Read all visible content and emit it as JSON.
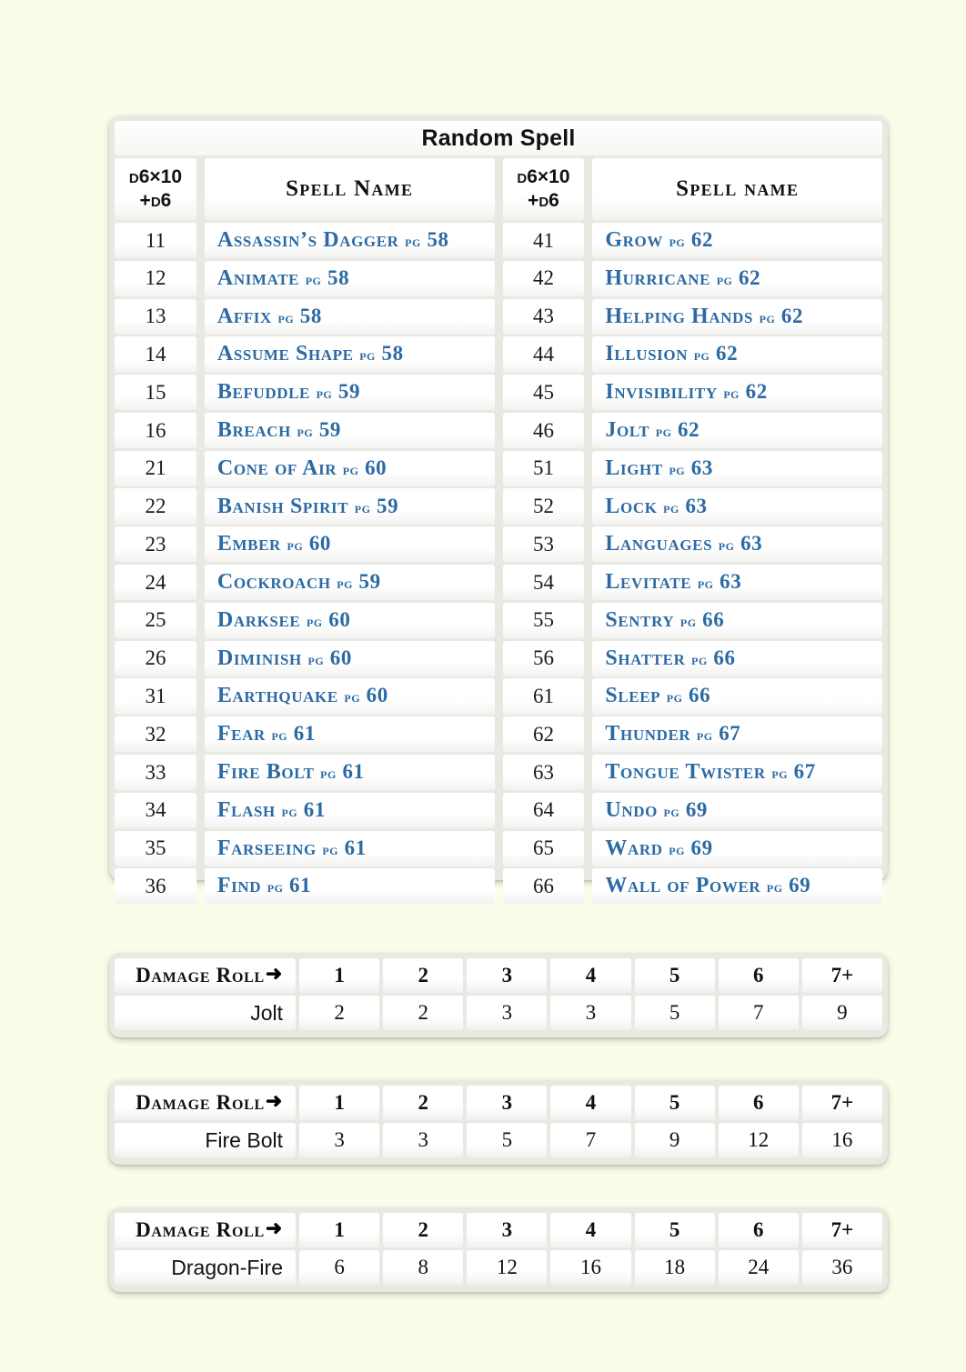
{
  "background_color": "#fbfce9",
  "accent_color": "#2b6aa4",
  "spell_table": {
    "title": "Random Spell",
    "headers": {
      "roll_line1": "D6×10",
      "roll_line2": "+D6",
      "name_left": "Spell Name",
      "name_right": "Spell name"
    },
    "left_column": [
      {
        "roll": "11",
        "name": "Assassin’s Dagger",
        "pg": "pg",
        "page": "58"
      },
      {
        "roll": "12",
        "name": "Animate",
        "pg": "pg",
        "page": "58"
      },
      {
        "roll": "13",
        "name": "Affix",
        "pg": "pg",
        "page": "58"
      },
      {
        "roll": "14",
        "name": "Assume Shape",
        "pg": "pg",
        "page": "58"
      },
      {
        "roll": "15",
        "name": "Befuddle",
        "pg": "pg",
        "page": "59"
      },
      {
        "roll": "16",
        "name": "Breach",
        "pg": "pg",
        "page": "59"
      },
      {
        "roll": "21",
        "name": "Cone of Air",
        "pg": "pg",
        "page": "60"
      },
      {
        "roll": "22",
        "name": "Banish Spirit",
        "pg": "pg",
        "page": "59"
      },
      {
        "roll": "23",
        "name": "Ember",
        "pg": "pg",
        "page": "60"
      },
      {
        "roll": "24",
        "name": "Cockroach",
        "pg": "pg",
        "page": "59"
      },
      {
        "roll": "25",
        "name": "Darksee",
        "pg": "pg",
        "page": "60"
      },
      {
        "roll": "26",
        "name": "Diminish",
        "pg": "pg",
        "page": "60"
      },
      {
        "roll": "31",
        "name": "Earthquake",
        "pg": "pg",
        "page": "60"
      },
      {
        "roll": "32",
        "name": "Fear",
        "pg": "pg",
        "page": "61"
      },
      {
        "roll": "33",
        "name": "Fire Bolt",
        "pg": "pg",
        "page": "61"
      },
      {
        "roll": "34",
        "name": "Flash",
        "pg": "pg",
        "page": "61"
      },
      {
        "roll": "35",
        "name": "Farseeing",
        "pg": "pg",
        "page": "61"
      },
      {
        "roll": "36",
        "name": "Find",
        "pg": "pg",
        "page": "61"
      }
    ],
    "right_column": [
      {
        "roll": "41",
        "name": "Grow",
        "pg": "pg",
        "page": "62"
      },
      {
        "roll": "42",
        "name": "Hurricane",
        "pg": "pg",
        "page": "62"
      },
      {
        "roll": "43",
        "name": "Helping Hands",
        "pg": "pg",
        "page": "62"
      },
      {
        "roll": "44",
        "name": "Illusion",
        "pg": "pg",
        "page": "62"
      },
      {
        "roll": "45",
        "name": "Invisibility",
        "pg": "pg",
        "page": "62"
      },
      {
        "roll": "46",
        "name": "Jolt",
        "pg": "pg",
        "page": "62"
      },
      {
        "roll": "51",
        "name": "Light",
        "pg": "pg",
        "page": "63"
      },
      {
        "roll": "52",
        "name": "Lock",
        "pg": "pg",
        "page": "63"
      },
      {
        "roll": "53",
        "name": "Languages",
        "pg": "pg",
        "page": "63"
      },
      {
        "roll": "54",
        "name": "Levitate",
        "pg": "pg",
        "page": "63"
      },
      {
        "roll": "55",
        "name": "Sentry",
        "pg": "pg",
        "page": "66"
      },
      {
        "roll": "56",
        "name": "Shatter",
        "pg": "pg",
        "page": "66"
      },
      {
        "roll": "61",
        "name": "Sleep",
        "pg": "pg",
        "page": "66"
      },
      {
        "roll": "62",
        "name": "Thunder",
        "pg": "pg",
        "page": "67"
      },
      {
        "roll": "63",
        "name": "Tongue Twister",
        "pg": "pg",
        "page": "67"
      },
      {
        "roll": "64",
        "name": "Undo",
        "pg": "pg",
        "page": "69"
      },
      {
        "roll": "65",
        "name": "Ward",
        "pg": "pg",
        "page": "69"
      },
      {
        "roll": "66",
        "name": "Wall of Power",
        "pg": "pg",
        "page": "69"
      }
    ]
  },
  "damage_tables": [
    {
      "header_label": "Damage Roll",
      "arrow_icon": "➜",
      "columns": [
        "1",
        "2",
        "3",
        "4",
        "5",
        "6",
        "7+"
      ],
      "spell_label": "Jolt",
      "values": [
        "2",
        "2",
        "3",
        "3",
        "5",
        "7",
        "9"
      ]
    },
    {
      "header_label": "Damage Roll",
      "arrow_icon": "➜",
      "columns": [
        "1",
        "2",
        "3",
        "4",
        "5",
        "6",
        "7+"
      ],
      "spell_label": "Fire Bolt",
      "values": [
        "3",
        "3",
        "5",
        "7",
        "9",
        "12",
        "16"
      ]
    },
    {
      "header_label": "Damage Roll",
      "arrow_icon": "➜",
      "columns": [
        "1",
        "2",
        "3",
        "4",
        "5",
        "6",
        "7+"
      ],
      "spell_label": "Dragon-Fire",
      "values": [
        "6",
        "8",
        "12",
        "16",
        "18",
        "24",
        "36"
      ]
    }
  ]
}
